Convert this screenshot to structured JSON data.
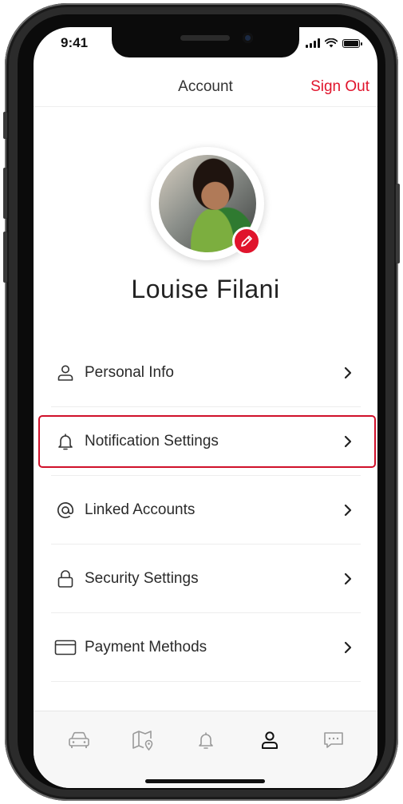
{
  "status_bar": {
    "time": "9:41",
    "signal_icon": "signal-icon",
    "wifi_icon": "wifi-icon",
    "battery_icon": "battery-icon"
  },
  "header": {
    "title": "Account",
    "sign_out_label": "Sign Out"
  },
  "profile": {
    "name": "Louise Filani",
    "avatar": "profile-photo",
    "edit_icon": "pencil-icon"
  },
  "menu": {
    "items": [
      {
        "label": "Personal Info",
        "icon": "person-icon"
      },
      {
        "label": "Notification Settings",
        "icon": "bell-icon",
        "highlighted": true
      },
      {
        "label": "Linked Accounts",
        "icon": "at-sign-icon"
      },
      {
        "label": "Security Settings",
        "icon": "lock-icon"
      },
      {
        "label": "Payment Methods",
        "icon": "credit-card-icon"
      }
    ]
  },
  "tab_bar": {
    "tabs": [
      {
        "icon": "car-icon"
      },
      {
        "icon": "map-icon"
      },
      {
        "icon": "bell-icon"
      },
      {
        "icon": "person-icon",
        "active": true
      },
      {
        "icon": "chat-icon"
      }
    ]
  },
  "colors": {
    "accent": "#e0142c",
    "highlight_border": "#d0102a",
    "text": "#2a2a2a",
    "inactive_icon": "#9a9a9a"
  }
}
